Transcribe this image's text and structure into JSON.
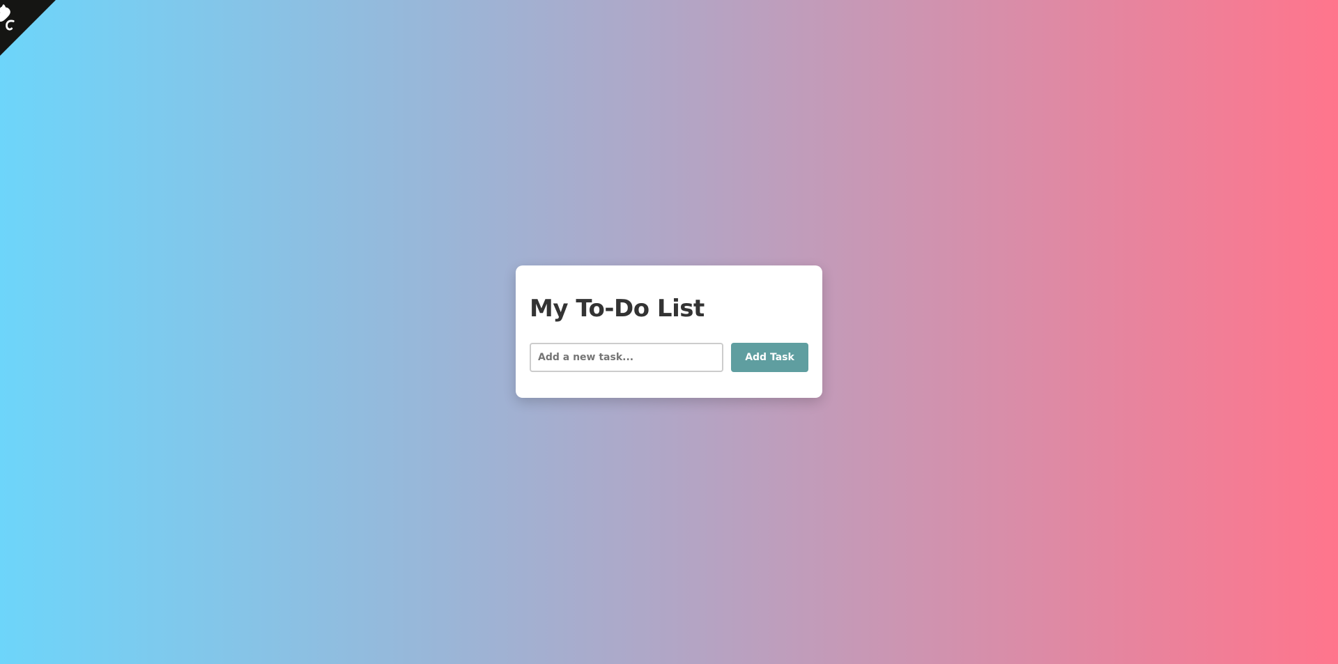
{
  "page": {
    "background_gradient": [
      "#6dd5fa",
      "#b1a6c6",
      "#ff758c"
    ]
  },
  "corner": {
    "icon": "github-octocat-icon",
    "background": "#151513",
    "foreground": "#ffffff"
  },
  "todo": {
    "title": "My To-Do List",
    "input": {
      "placeholder": "Add a new task...",
      "value": ""
    },
    "add_button_label": "Add Task",
    "button_color": "#5f9ea0"
  }
}
